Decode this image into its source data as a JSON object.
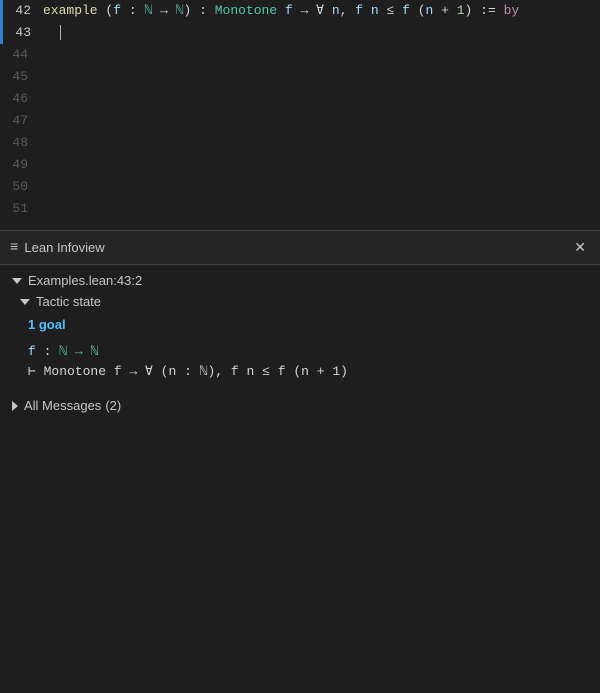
{
  "editor": {
    "lines": [
      {
        "number": "42",
        "active": true,
        "hasIndicator": true,
        "content": ""
      },
      {
        "number": "43",
        "active": true,
        "hasIndicator": true,
        "content": "",
        "hasCursor": true
      },
      {
        "number": "44",
        "active": false,
        "hasIndicator": false,
        "content": ""
      },
      {
        "number": "45",
        "active": false,
        "hasIndicator": false,
        "content": ""
      },
      {
        "number": "46",
        "active": false,
        "hasIndicator": false,
        "content": ""
      },
      {
        "number": "47",
        "active": false,
        "hasIndicator": false,
        "content": ""
      },
      {
        "number": "48",
        "active": false,
        "hasIndicator": false,
        "content": ""
      },
      {
        "number": "49",
        "active": false,
        "hasIndicator": false,
        "content": ""
      },
      {
        "number": "50",
        "active": false,
        "hasIndicator": false,
        "content": ""
      },
      {
        "number": "51",
        "active": false,
        "hasIndicator": false,
        "content": ""
      }
    ],
    "line42_text": "example (f : ℕ → ℕ) : Monotone f → ∀ n, f n ≤ f (n + 1) := by",
    "line43_indent": "  "
  },
  "infoview": {
    "title": "Lean Infoview",
    "close_label": "✕",
    "location": "Examples.lean:43:2",
    "tactic_state_label": "Tactic state",
    "goal_count": "1 goal",
    "hypothesis": {
      "var_name": "f",
      "colon": ":",
      "type": "ℕ → ℕ"
    },
    "goal_line": "⊢ Monotone f → ∀ (n : ℕ), f n ≤ f (n + 1)",
    "all_messages_label": "All Messages",
    "all_messages_count": "(2)"
  }
}
